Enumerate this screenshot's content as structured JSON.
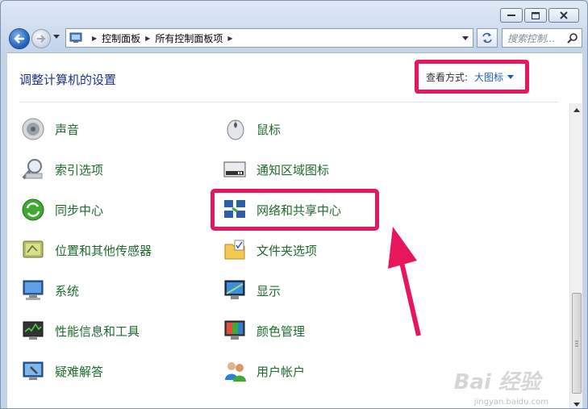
{
  "window": {
    "caption_buttons": [
      "minimize",
      "maximize",
      "close"
    ]
  },
  "address_bar": {
    "crumbs": [
      "控制面板",
      "所有控制面板项"
    ]
  },
  "search": {
    "placeholder": "搜索控制..."
  },
  "header": {
    "title": "调整计算机的设置",
    "view_by_label": "查看方式:",
    "view_by_value": "大图标"
  },
  "items_left": [
    {
      "label": "声音",
      "icon": "speaker-icon"
    },
    {
      "label": "索引选项",
      "icon": "magnifier-icon"
    },
    {
      "label": "同步中心",
      "icon": "sync-icon"
    },
    {
      "label": "位置和其他传感器",
      "icon": "sensor-icon"
    },
    {
      "label": "系统",
      "icon": "system-icon"
    },
    {
      "label": "性能信息和工具",
      "icon": "performance-icon"
    },
    {
      "label": "疑难解答",
      "icon": "troubleshoot-icon"
    }
  ],
  "items_right": [
    {
      "label": "鼠标",
      "icon": "mouse-icon"
    },
    {
      "label": "通知区域图标",
      "icon": "tray-icon"
    },
    {
      "label": "网络和共享中心",
      "icon": "network-icon"
    },
    {
      "label": "文件夹选项",
      "icon": "folder-icon"
    },
    {
      "label": "显示",
      "icon": "display-icon"
    },
    {
      "label": "颜色管理",
      "icon": "color-icon"
    },
    {
      "label": "用户帐户",
      "icon": "users-icon"
    }
  ],
  "watermark": {
    "text": "Bai 经验",
    "sub": "jingyan.baidu.com"
  },
  "colors": {
    "highlight": "#e8175d",
    "link_green": "#1d6b2e",
    "title_blue": "#1e3287"
  }
}
